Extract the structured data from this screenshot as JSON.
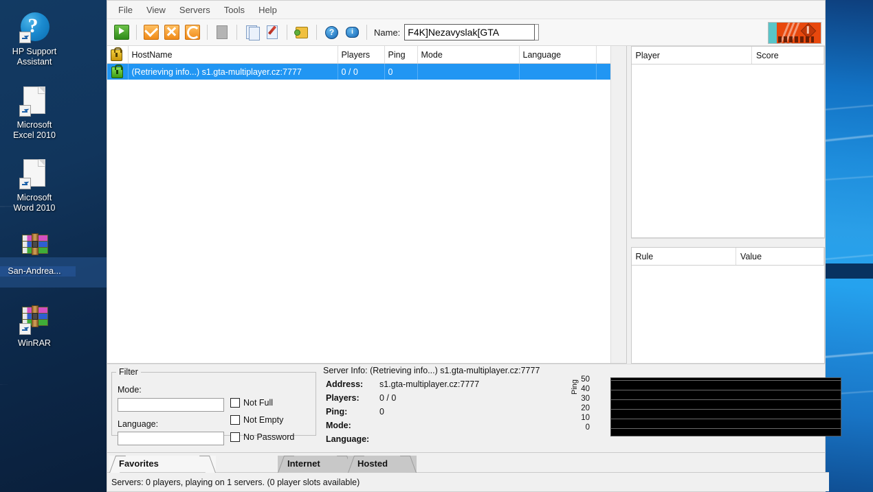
{
  "desktop": {
    "icons": [
      {
        "label": "HP Support\nAssistant",
        "label_line1": "HP Support",
        "label_line2": "Assistant",
        "icon": "hp-support-icon",
        "selected": false
      },
      {
        "label_line1": "Microsoft",
        "label_line2": "Excel 2010",
        "icon": "excel-shortcut-icon",
        "selected": false
      },
      {
        "label_line1": "Microsoft",
        "label_line2": "Word 2010",
        "icon": "word-shortcut-icon",
        "selected": false
      },
      {
        "label_line1": "San-Andrea...",
        "label_line2": "",
        "icon": "winrar-archive-icon",
        "selected": true
      },
      {
        "label_line1": "WinRAR",
        "label_line2": "",
        "icon": "winrar-shortcut-icon",
        "selected": false
      }
    ]
  },
  "app": {
    "menu": [
      "File",
      "View",
      "Servers",
      "Tools",
      "Help"
    ],
    "toolbar": {
      "buttons": [
        {
          "name": "play-connect-button",
          "icon": "play-icon"
        },
        {
          "name": "add-server-button",
          "icon": "checkmark-icon"
        },
        {
          "name": "delete-server-button",
          "icon": "cross-icon"
        },
        {
          "name": "refresh-button",
          "icon": "refresh-icon"
        },
        {
          "name": "new-page-button",
          "icon": "page-icon"
        },
        {
          "name": "copy-button",
          "icon": "copy-icon"
        },
        {
          "name": "edit-button",
          "icon": "edit-pencil-icon"
        },
        {
          "name": "plugins-button",
          "icon": "puzzle-icon"
        },
        {
          "name": "help-button",
          "icon": "question-circle-icon"
        },
        {
          "name": "about-button",
          "icon": "info-speech-icon"
        }
      ],
      "name_label": "Name:",
      "name_value": "F4K]Nezavyslak[GTA",
      "name_placeholder": "Name"
    },
    "server_list": {
      "columns": [
        "HostName",
        "Players",
        "Ping",
        "Mode",
        "Language"
      ],
      "rows": [
        {
          "locked": true,
          "hostname": "(Retrieving info...) s1.gta-multiplayer.cz:7777",
          "players": "0 / 0",
          "ping": "0",
          "mode": "",
          "language": "",
          "selected": true
        }
      ]
    },
    "players_panel": {
      "columns": [
        "Player",
        "Score"
      ],
      "rows": []
    },
    "rules_panel": {
      "columns": [
        "Rule",
        "Value"
      ],
      "rows": []
    },
    "filter": {
      "legend": "Filter",
      "mode_label": "Mode:",
      "mode_value": "",
      "language_label": "Language:",
      "language_value": "",
      "checkboxes": [
        {
          "label": "Not Full",
          "checked": false
        },
        {
          "label": "Not Empty",
          "checked": false
        },
        {
          "label": "No Password",
          "checked": false
        }
      ]
    },
    "server_info": {
      "title": "Server Info: (Retrieving info...) s1.gta-multiplayer.cz:7777",
      "rows": [
        {
          "key": "Address:",
          "value": "s1.gta-multiplayer.cz:7777"
        },
        {
          "key": "Players:",
          "value": "0 / 0"
        },
        {
          "key": "Ping:",
          "value": "0"
        },
        {
          "key": "Mode:",
          "value": ""
        },
        {
          "key": "Language:",
          "value": ""
        }
      ]
    },
    "tabs": [
      {
        "label": "Favorites",
        "active": true
      },
      {
        "label": "Internet",
        "active": false
      },
      {
        "label": "Hosted",
        "active": false
      }
    ],
    "status": "Servers: 0 players, playing on 1 servers. (0 player slots available)"
  },
  "chart_data": {
    "type": "line",
    "title": "",
    "xlabel": "",
    "ylabel": "Ping",
    "ylim": [
      0,
      50
    ],
    "yticks": [
      50,
      40,
      30,
      20,
      10,
      0
    ],
    "x": [],
    "values": [],
    "grid": true,
    "background": "#000000",
    "gridline_color": "#6a6a6a"
  },
  "colors": {
    "selection_blue": "#2196f3",
    "window_chrome": "#f0f0f0",
    "accent_orange": "#e8480d",
    "wallpaper_blue": "#1272c4"
  }
}
